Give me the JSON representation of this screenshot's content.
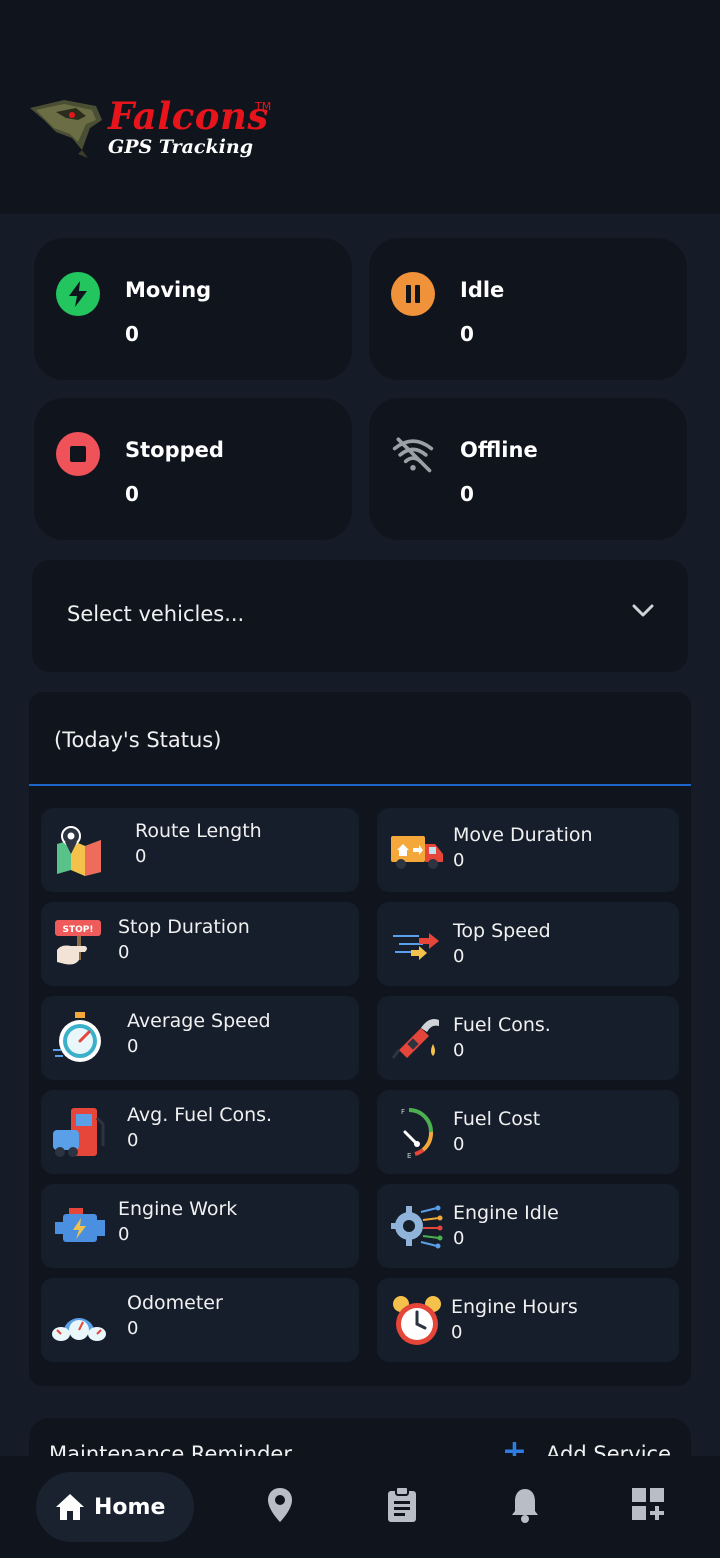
{
  "brand": {
    "name": "Falcons",
    "tm": "TM",
    "tagline": "GPS Tracking"
  },
  "stats": [
    {
      "label": "Moving",
      "value": "0",
      "icon": "lightning-icon",
      "color": "#22c55e"
    },
    {
      "label": "Idle",
      "value": "0",
      "icon": "pause-icon",
      "color": "#f0923a"
    },
    {
      "label": "Stopped",
      "value": "0",
      "icon": "stop-icon",
      "color": "#f0525a"
    },
    {
      "label": "Offline",
      "value": "0",
      "icon": "wifi-off-icon",
      "color": "#9aa0a6"
    }
  ],
  "vehicle_select": {
    "placeholder": "Select vehicles..."
  },
  "status": {
    "title": "(Today's Status)",
    "metrics": [
      {
        "label": "Route Length",
        "value": "0",
        "icon": "map-pin-icon"
      },
      {
        "label": "Move Duration",
        "value": "0",
        "icon": "truck-icon"
      },
      {
        "label": "Stop Duration",
        "value": "0",
        "icon": "stop-sign-hand-icon"
      },
      {
        "label": "Top Speed",
        "value": "0",
        "icon": "speed-arrows-icon"
      },
      {
        "label": "Average Speed",
        "value": "0",
        "icon": "stopwatch-icon"
      },
      {
        "label": "Fuel Cons.",
        "value": "0",
        "icon": "fuel-nozzle-icon"
      },
      {
        "label": "Avg. Fuel Cons.",
        "value": "0",
        "icon": "fuel-pump-icon"
      },
      {
        "label": "Fuel Cost",
        "value": "0",
        "icon": "fuel-gauge-icon"
      },
      {
        "label": "Engine Work",
        "value": "0",
        "icon": "engine-icon"
      },
      {
        "label": "Engine Idle",
        "value": "0",
        "icon": "engine-gear-icon"
      },
      {
        "label": "Odometer",
        "value": "0",
        "icon": "odometer-icon"
      },
      {
        "label": "Engine Hours",
        "value": "0",
        "icon": "alarm-clock-icon"
      }
    ]
  },
  "maintenance": {
    "title": "Maintenance Reminder",
    "add_label": "Add Service"
  },
  "nav": {
    "home_label": "Home"
  }
}
